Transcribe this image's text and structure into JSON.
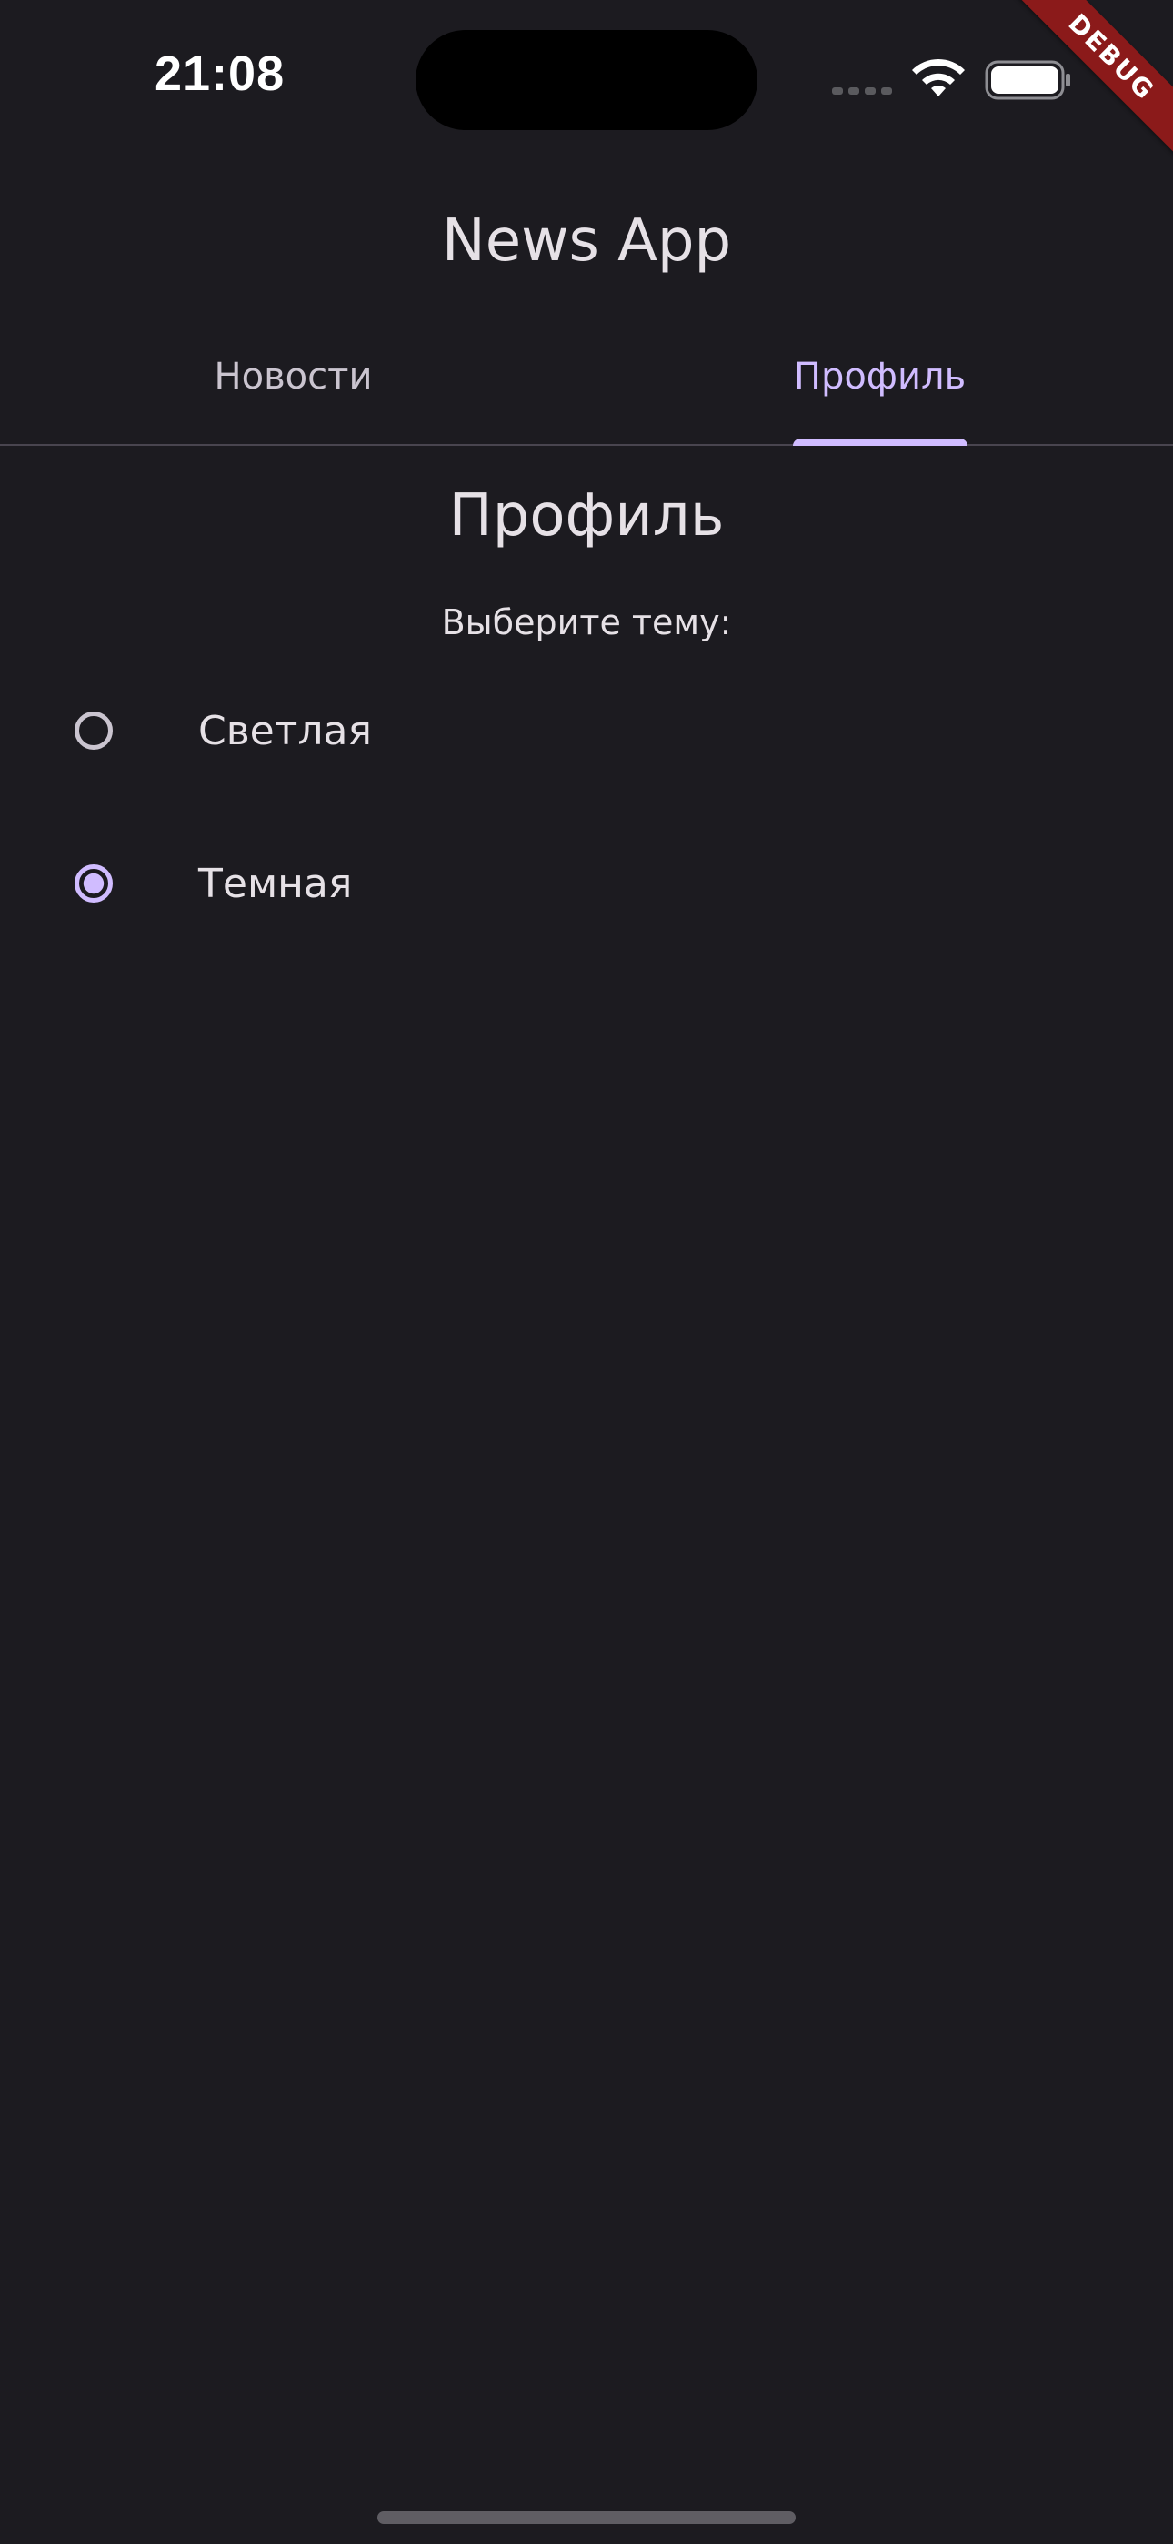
{
  "status_bar": {
    "time": "21:08",
    "icons": [
      "signal-icon",
      "wifi-icon",
      "battery-icon"
    ]
  },
  "debug_banner": "DEBUG",
  "app_bar": {
    "title": "News App"
  },
  "tabs": [
    {
      "label": "Новости",
      "active": false
    },
    {
      "label": "Профиль",
      "active": true
    }
  ],
  "profile": {
    "heading": "Профиль",
    "theme_prompt": "Выберите тему:",
    "options": [
      {
        "label": "Светлая",
        "selected": false
      },
      {
        "label": "Темная",
        "selected": true
      }
    ]
  },
  "colors": {
    "background": "#1c1b20",
    "accent": "#d0bcff",
    "text": "#e6e1e6",
    "muted_text": "#cac4cf",
    "debug_ribbon": "#8b1a1a"
  }
}
